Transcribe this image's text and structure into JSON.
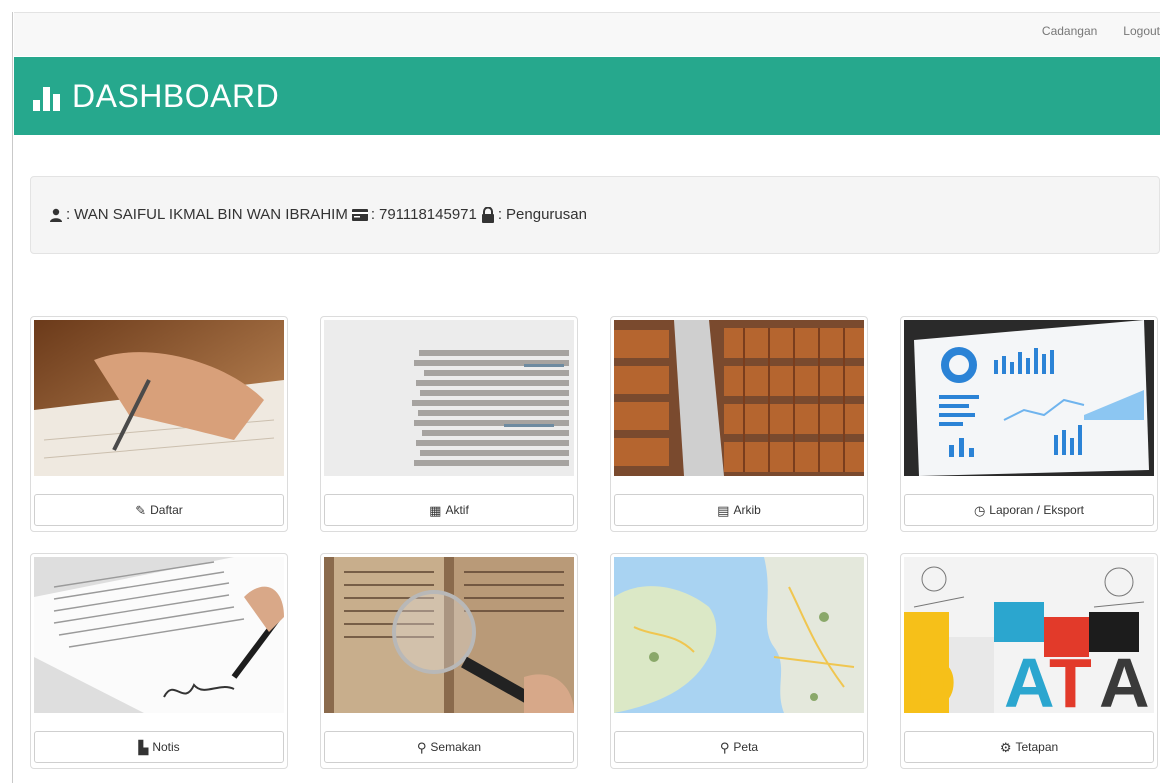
{
  "topnav": {
    "links": [
      "Cadangan",
      "Logout"
    ]
  },
  "header": {
    "title": "DASHBOARD"
  },
  "user": {
    "name": "WAN SAIFUL IKMAL BIN WAN IBRAHIM",
    "ic_number": "791118145971",
    "role": "Pengurusan",
    "name_prefix": ":",
    "ic_prefix": ":",
    "role_prefix": ":"
  },
  "menu": [
    {
      "label": "Daftar",
      "icon": "edit-icon",
      "glyph": "✎"
    },
    {
      "label": "Aktif",
      "icon": "grid-icon",
      "glyph": "▦"
    },
    {
      "label": "Arkib",
      "icon": "archive-icon",
      "glyph": "▤"
    },
    {
      "label": "Laporan / Eksport",
      "icon": "clock-icon",
      "glyph": "◷"
    },
    {
      "label": "Notis",
      "icon": "file-icon",
      "glyph": "▙"
    },
    {
      "label": "Semakan",
      "icon": "search-icon",
      "glyph": "⚲"
    },
    {
      "label": "Peta",
      "icon": "map-marker-icon",
      "glyph": "⚲"
    },
    {
      "label": "Tetapan",
      "icon": "gear-icon",
      "glyph": "⚙"
    }
  ],
  "colors": {
    "header": "#26a88d",
    "navbar": "#f8f8f8",
    "panel": "#f5f5f5"
  }
}
